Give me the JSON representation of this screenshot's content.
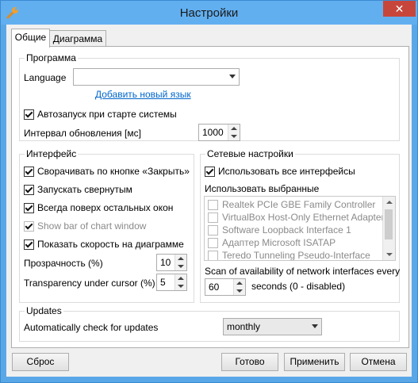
{
  "window": {
    "title": "Настройки",
    "close_glyph": "✕",
    "icon": "wrench-icon"
  },
  "tabs": [
    {
      "label": "Общие",
      "active": true
    },
    {
      "label": "Диаграмма",
      "active": false
    }
  ],
  "program": {
    "title": "Программа",
    "language_label": "Language",
    "language_value": "",
    "add_language_link": "Добавить новый язык",
    "autostart_label": "Автозапуск при старте системы",
    "autostart_checked": true,
    "interval_label": "Интервал обновления [мс]",
    "interval_value": "1000"
  },
  "interface": {
    "title": "Интерфейс",
    "options": [
      {
        "label": "Сворачивать по кнопке «Закрыть»",
        "checked": true,
        "disabled": false
      },
      {
        "label": "Запускать свернутым",
        "checked": true,
        "disabled": false
      },
      {
        "label": "Всегда поверх остальных окон",
        "checked": true,
        "disabled": false
      },
      {
        "label": "Show bar of chart window",
        "checked": true,
        "disabled": true
      },
      {
        "label": "Показать скорость на диаграмме",
        "checked": true,
        "disabled": false
      }
    ],
    "transparency_label": "Прозрачность (%)",
    "transparency_value": "10",
    "transparency_cursor_label": "Transparency under cursor (%)",
    "transparency_cursor_value": "5"
  },
  "network": {
    "title": "Сетевые настройки",
    "use_all_label": "Использовать все интерфейсы",
    "use_all_checked": true,
    "use_selected_label": "Использовать выбранные",
    "interfaces": [
      "Realtek PCIe GBE Family Controller",
      "VirtualBox Host-Only Ethernet Adapter",
      "Software Loopback Interface 1",
      "Адаптер Microsoft ISATAP",
      "Teredo Tunneling Pseudo-Interface"
    ],
    "scan_label": "Scan of availability of network interfaces every",
    "scan_value": "60",
    "scan_suffix": "seconds (0 - disabled)"
  },
  "updates": {
    "title": "Updates",
    "check_label": "Automatically check for updates",
    "check_value": "monthly"
  },
  "buttons": {
    "reset": "Сброс",
    "ok": "Готово",
    "apply": "Применить",
    "cancel": "Отмена"
  }
}
